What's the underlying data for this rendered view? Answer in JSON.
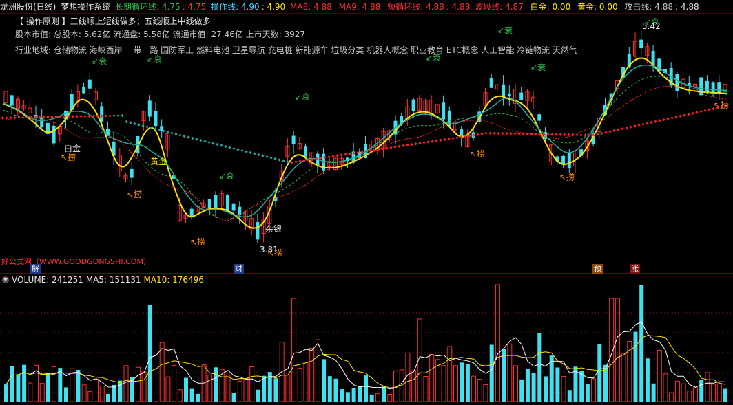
{
  "header": {
    "stock_title": "龙洲股份(日线)",
    "formula_name": "梦想操作系统",
    "ind_long_cycle_label": "长期循环线: 4.75",
    "ind_long_cycle_value": ": 4.75",
    "ind_operation_label": "操作线: 4.90",
    "ind_operation_value": ": 4.90",
    "ind_ma8_label": "MA8: 4.88",
    "ind_ma8_value": "",
    "ind_ma9_label": "MA9: 4.88",
    "ind_ma9_value": "",
    "ind_short_cycle_label": "短循环线: 4.88",
    "ind_short_cycle_value": ": 4.88",
    "ind_band_label": "波段线: 4.87",
    "ind_band_value": "",
    "ind_white_gold_label": "白金: 0.00",
    "ind_white_gold_value": "",
    "ind_yellow_gold_label": "黄金: 0.00",
    "ind_yellow_gold_value": "",
    "ind_attack_label": "攻击线: 4.88",
    "ind_attack_value": ": 4.88"
  },
  "info": {
    "principle": "【 操作原则 】三线顺上短线做多；五线顺上中线做多",
    "cap_line": "股本市值: 总股本: 5.62亿 流通盘: 5.58亿 流通市值: 27.46亿 上市天数: 3927",
    "industry_line": "行业地域: 仓储物流 海峡西岸 一带一路 国防军工 燃料电池 卫星导航 充电桩 新能源车 垃圾分类 机器人概念 职业教育 ETC概念 人工智能 冷链物流 天然气"
  },
  "annotations": {
    "white_gold": "白金",
    "yellow_gold": "黄金",
    "mixed_silver": "杂银",
    "low_price": "3.81",
    "high_price": "5.42",
    "decline": "衰",
    "rebound": "捞"
  },
  "watermark": "好公式网（WWW.GOODGONGSHI.COM）",
  "events": [
    {
      "label": "解"
    },
    {
      "label": "财"
    },
    {
      "label": "预"
    },
    {
      "label": "涨"
    }
  ],
  "volume": {
    "label": "VOLUME: 241251",
    "value": "",
    "ma5_label": "MA5: 151131",
    "ma5_value": "",
    "ma10_label": "MA10: 176496",
    "ma10_value": ""
  },
  "colors": {
    "up": "#ff3030",
    "down": "#3fe0f0",
    "ma_yellow": "#ffe600",
    "ma_teal": "#1fb3a6",
    "ma_green": "#2fbf4b",
    "dotted_red": "#ff2020",
    "dotted_teal": "#2aa6a0",
    "grid_red": "#8a1a1a",
    "white_line": "#e6e6e6"
  }
}
